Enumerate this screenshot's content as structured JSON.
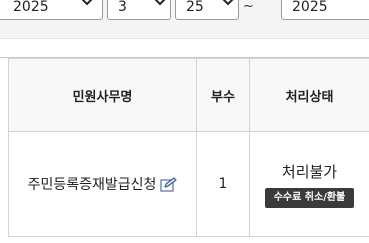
{
  "filters": {
    "start_year": "2025",
    "start_month": "3",
    "start_day": "25",
    "range_separator": "~",
    "end_year": "2025"
  },
  "table": {
    "headers": {
      "name": "민원사무명",
      "copies": "부수",
      "status": "처리상태"
    },
    "rows": [
      {
        "name": "주민등록증재발급신청",
        "copies": "1",
        "status": "처리불가",
        "action": "수수료 취소/환불"
      }
    ]
  },
  "icons": {
    "edit": "edit-icon",
    "dropdown": "chevron-down-icon"
  },
  "colors": {
    "button_bg": "#3b3b3b",
    "header_bg": "#f8f8f8",
    "filter_bg": "#f5f5f5"
  }
}
